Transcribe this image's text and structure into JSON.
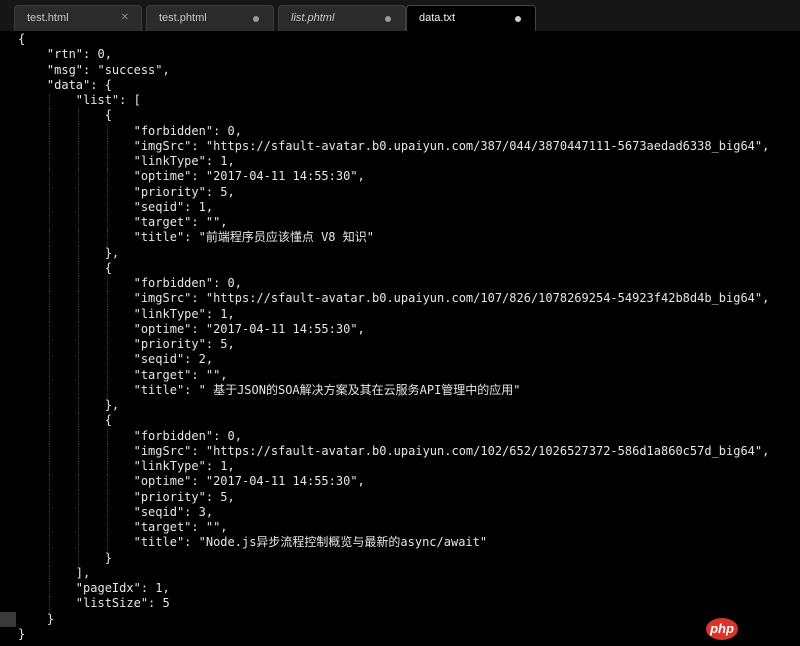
{
  "tabs": [
    {
      "label": "test.html",
      "state": "close",
      "italic": false,
      "active": false
    },
    {
      "label": "test.phtml",
      "state": "modified",
      "italic": false,
      "active": false
    },
    {
      "label": "list.phtml",
      "state": "modified",
      "italic": true,
      "active": false
    },
    {
      "label": "data.txt",
      "state": "modified",
      "italic": false,
      "active": true
    }
  ],
  "editor": {
    "current_line": 39,
    "lines": [
      "{",
      "    \"rtn\": 0,",
      "    \"msg\": \"success\",",
      "    \"data\": {",
      "        \"list\": [",
      "            {",
      "                \"forbidden\": 0,",
      "                \"imgSrc\": \"https://sfault-avatar.b0.upaiyun.com/387/044/3870447111-5673aedad6338_big64\",",
      "                \"linkType\": 1,",
      "                \"optime\": \"2017-04-11 14:55:30\",",
      "                \"priority\": 5,",
      "                \"seqid\": 1,",
      "                \"target\": \"\",",
      "                \"title\": \"前端程序员应该懂点 V8 知识\"",
      "            },",
      "            {",
      "                \"forbidden\": 0,",
      "                \"imgSrc\": \"https://sfault-avatar.b0.upaiyun.com/107/826/1078269254-54923f42b8d4b_big64\",",
      "                \"linkType\": 1,",
      "                \"optime\": \"2017-04-11 14:55:30\",",
      "                \"priority\": 5,",
      "                \"seqid\": 2,",
      "                \"target\": \"\",",
      "                \"title\": \" 基于JSON的SOA解决方案及其在云服务API管理中的应用\"",
      "            },",
      "            {",
      "                \"forbidden\": 0,",
      "                \"imgSrc\": \"https://sfault-avatar.b0.upaiyun.com/102/652/1026527372-586d1a860c57d_big64\",",
      "                \"linkType\": 1,",
      "                \"optime\": \"2017-04-11 14:55:30\",",
      "                \"priority\": 5,",
      "                \"seqid\": 3,",
      "                \"target\": \"\",",
      "                \"title\": \"Node.js异步流程控制概览与最新的async/await\"",
      "            }",
      "        ],",
      "        \"pageIdx\": 1,",
      "        \"listSize\": 5",
      "    }",
      "}"
    ]
  },
  "watermark": {
    "text": "php",
    "color": "#d9342b"
  },
  "colors": {
    "background": "#000000",
    "text": "#e6e6e6",
    "tabbar": "#161616"
  }
}
